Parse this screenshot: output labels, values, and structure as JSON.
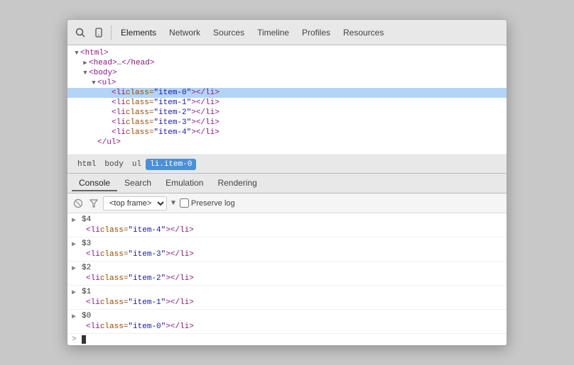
{
  "toolbar": {
    "search_icon": "🔍",
    "device_icon": "📱",
    "tabs": [
      {
        "label": "Elements",
        "active": true
      },
      {
        "label": "Network",
        "active": false
      },
      {
        "label": "Sources",
        "active": false
      },
      {
        "label": "Timeline",
        "active": false
      },
      {
        "label": "Profiles",
        "active": false
      },
      {
        "label": "Resources",
        "active": false
      }
    ]
  },
  "elements_panel": {
    "lines": [
      {
        "indent": 0,
        "triangle": "▼",
        "content": "<html>",
        "type": "tag",
        "selected": false
      },
      {
        "indent": 1,
        "triangle": "▶",
        "content": "<head>…</head>",
        "type": "tag",
        "selected": false
      },
      {
        "indent": 1,
        "triangle": "▼",
        "content": "<body>",
        "type": "tag",
        "selected": false
      },
      {
        "indent": 2,
        "triangle": "▼",
        "content": "<ul>",
        "type": "tag",
        "selected": false
      },
      {
        "indent": 3,
        "triangle": "",
        "content_pre": "<li ",
        "attr": "class=\"item-0\"",
        "content_post": "></li>",
        "selected": true
      },
      {
        "indent": 3,
        "triangle": "",
        "content_pre": "<li ",
        "attr": "class=\"item-1\"",
        "content_post": "></li>",
        "selected": false
      },
      {
        "indent": 3,
        "triangle": "",
        "content_pre": "<li ",
        "attr": "class=\"item-2\"",
        "content_post": "></li>",
        "selected": false
      },
      {
        "indent": 3,
        "triangle": "",
        "content_pre": "<li ",
        "attr": "class=\"item-3\"",
        "content_post": "></li>",
        "selected": false
      },
      {
        "indent": 3,
        "triangle": "",
        "content_pre": "<li ",
        "attr": "class=\"item-4\"",
        "content_post": "></li>",
        "selected": false
      },
      {
        "indent": 2,
        "triangle": "",
        "content": "</ul>",
        "type": "tag",
        "selected": false
      }
    ]
  },
  "breadcrumb": {
    "items": [
      {
        "label": "html",
        "active": false
      },
      {
        "label": "body",
        "active": false
      },
      {
        "label": "ul",
        "active": false
      },
      {
        "label": "li.item-0",
        "active": true
      }
    ]
  },
  "console_tabs": [
    {
      "label": "Console",
      "active": true
    },
    {
      "label": "Search",
      "active": false
    },
    {
      "label": "Emulation",
      "active": false
    },
    {
      "label": "Rendering",
      "active": false
    }
  ],
  "console_toolbar": {
    "frame_options": [
      "<top frame>"
    ],
    "preserve_log": "Preserve log"
  },
  "console_entries": [
    {
      "expandable": true,
      "var": "$4",
      "html": "<li class=\"item-4\"></li>"
    },
    {
      "expandable": true,
      "var": "$3",
      "html": "<li class=\"item-3\"></li>"
    },
    {
      "expandable": true,
      "var": "$2",
      "html": "<li class=\"item-2\"></li>"
    },
    {
      "expandable": true,
      "var": "$1",
      "html": "<li class=\"item-1\"></li>"
    },
    {
      "expandable": true,
      "var": "$0",
      "html": "<li class=\"item-0\"></li>"
    }
  ]
}
